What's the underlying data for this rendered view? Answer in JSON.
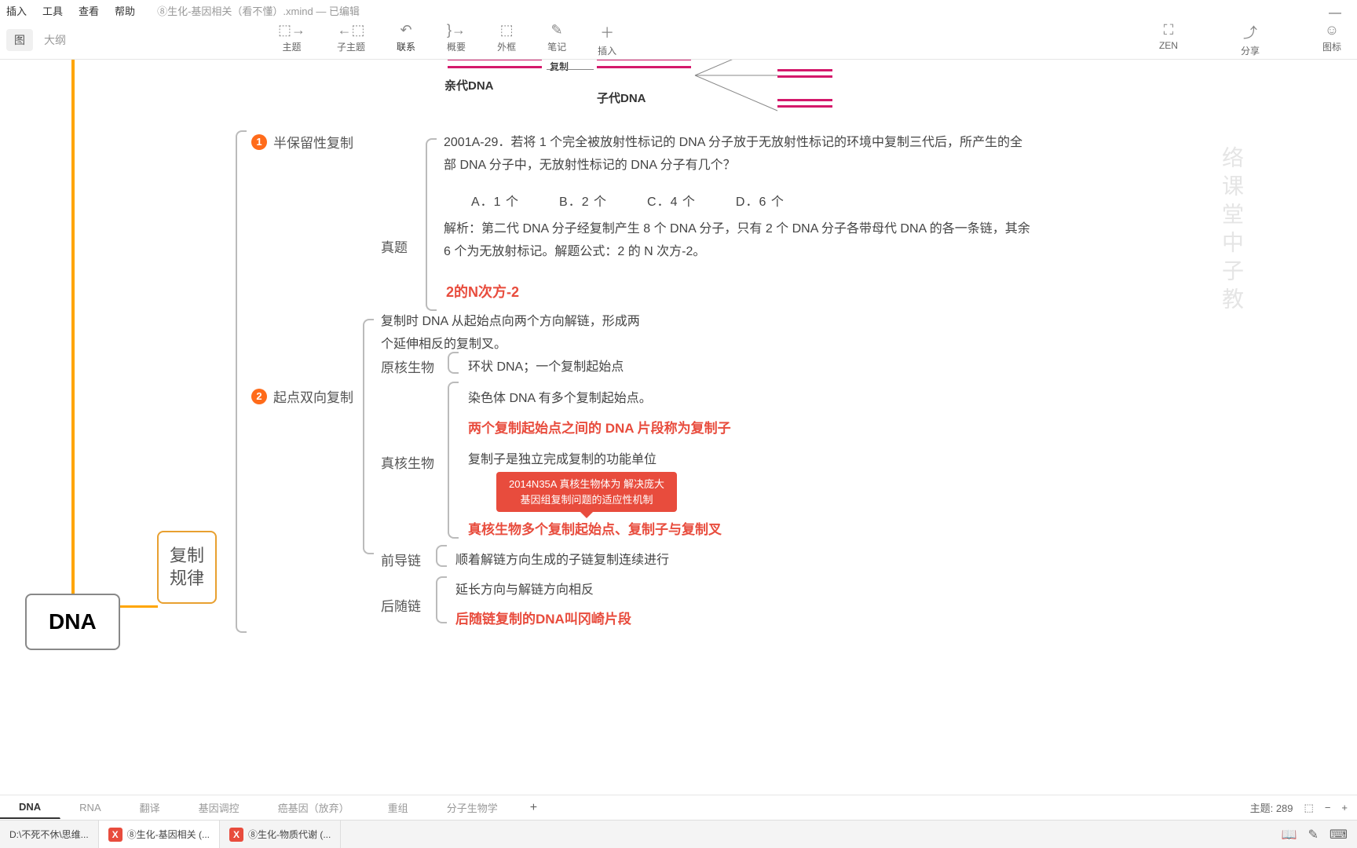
{
  "menu": {
    "items": [
      "插入",
      "工具",
      "查看",
      "帮助"
    ],
    "filename": "⑧生化-基因相关（看不懂）.xmind",
    "status": "— 已编辑"
  },
  "viewTabs": {
    "map": "图",
    "outline": "大纲"
  },
  "toolbar": {
    "topic": "主题",
    "subtopic": "子主题",
    "relation": "联系",
    "summary": "概要",
    "boundary": "外框",
    "note": "笔记",
    "insert": "插入",
    "zen": "ZEN",
    "share": "分享",
    "emoji": "图标"
  },
  "nodes": {
    "root": "DNA",
    "rule": "复制规律",
    "b1": "半保留性复制",
    "b1_q": "真题",
    "b1_qtext": "2001A-29．若将 1 个完全被放射性标记的 DNA 分子放于无放射性标记的环境中复制三代后，所产生的全部 DNA 分子中，无放射性标记的 DNA 分子有几个？",
    "b1_opts": "A．1 个　　　B．2 个　　　C．4 个　　　D．6 个",
    "b1_ans": "解析：第二代 DNA 分子经复制产生 8 个 DNA 分子，只有 2 个 DNA 分子各带母代 DNA 的各一条链，其余 6 个为无放射标记。解题公式：2 的 N 次方-2。",
    "b1_formula": "2的N次方-2",
    "b2": "起点双向复制",
    "b2_intro": "复制时 DNA 从起始点向两个方向解链，形成两个延伸相反的复制叉。",
    "b2_pro": "原核生物",
    "b2_pro_sub": "环状 DNA；一个复制起始点",
    "b2_eu": "真核生物",
    "b2_eu1": "染色体 DNA 有多个复制起始点。",
    "b2_eu2": "两个复制起始点之间的 DNA 片段称为复制子",
    "b2_eu3": "复制子是独立完成复制的功能单位",
    "b2_eu4": "真核生物多个复制起始点、复制子与复制叉",
    "annot": "2014N35A 真核生物体为\n解决庞大基因组复制问题的适应性机制",
    "b3_lead": "前导链",
    "b3_lead_sub": "顺着解链方向生成的子链复制连续进行",
    "b3_lag": "后随链",
    "b3_lag1": "延长方向与解链方向相反",
    "b3_lag2": "后随链复制的DNA叫冈崎片段",
    "dna_parent": "亲代DNA",
    "dna_child": "子代DNA",
    "dna_copy": "复制"
  },
  "tabs": [
    "DNA",
    "RNA",
    "翻译",
    "基因调控",
    "癌基因（放弃）",
    "重组",
    "分子生物学"
  ],
  "status": {
    "topics": "主题: 289"
  },
  "tasks": {
    "path": "D:\\不死不休\\思维...",
    "t1": "⑧生化-基因相关 (...",
    "t2": "⑧生化-物质代谢 (..."
  },
  "watermark": "络课堂中子教"
}
